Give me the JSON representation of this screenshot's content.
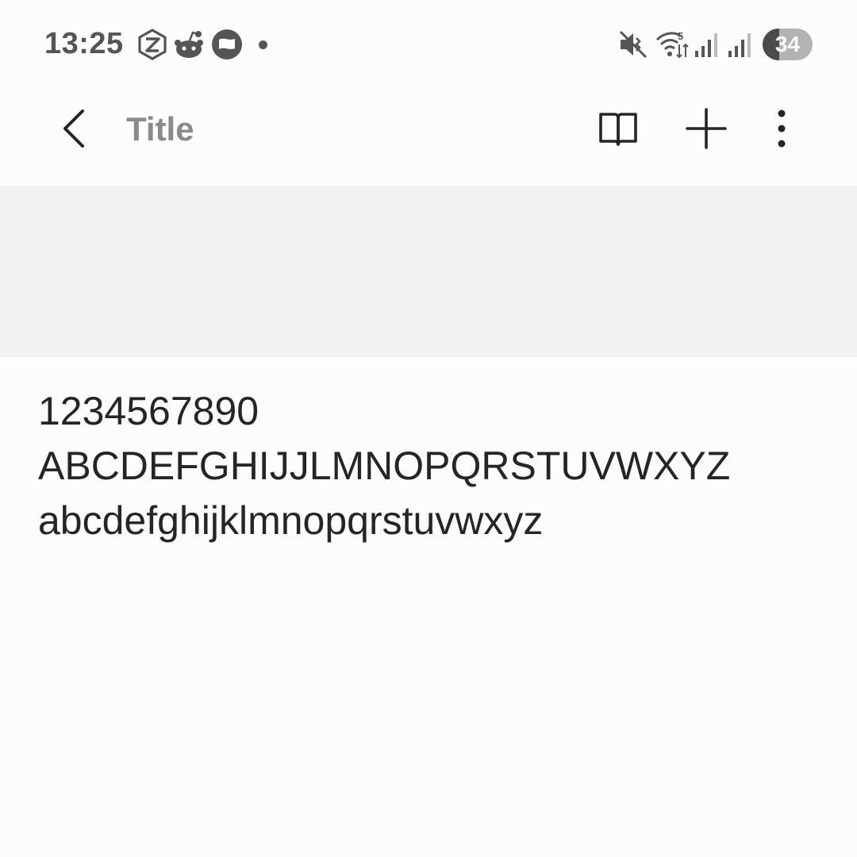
{
  "status_bar": {
    "time": "13:25",
    "notification_icons": [
      "zlibrary-icon",
      "reddit-icon",
      "messaging-app-icon",
      "notification-dot"
    ],
    "system_icons": [
      "muted-vibrate-icon",
      "wifi-icon",
      "signal-icon",
      "signal-icon"
    ],
    "wifi_label": "5",
    "battery": {
      "level": "34",
      "fraction": 0.34
    }
  },
  "app_bar": {
    "title": "Title",
    "actions": [
      "book-icon",
      "add-icon",
      "more-vertical-icon"
    ]
  },
  "content": {
    "lines": [
      "1234567890",
      "ABCDEFGHIJJLMNOPQRSTUVWXYZ",
      "abcdefghijklmnopqrstuvwxyz"
    ]
  },
  "colors": {
    "background": "#fcfcfc",
    "band": "#f2f2f2",
    "text": "#252525",
    "title": "#8a8a8a",
    "status_icons": "#555555"
  }
}
